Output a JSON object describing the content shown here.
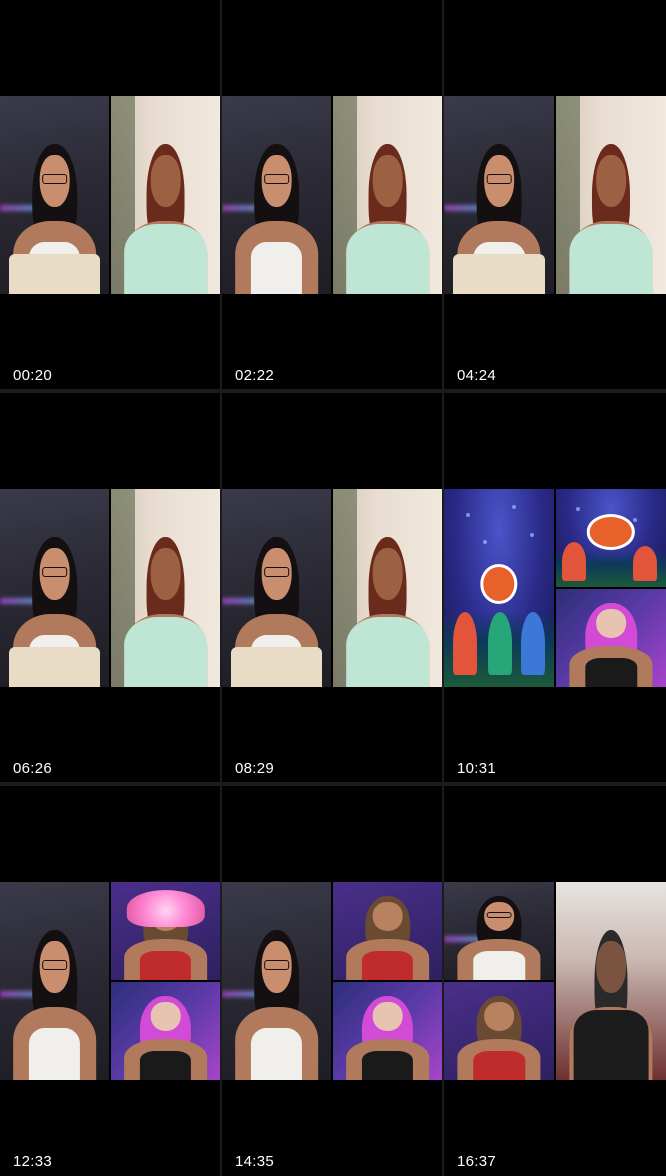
{
  "thumbnails": [
    {
      "timestamp": "00:20"
    },
    {
      "timestamp": "02:22"
    },
    {
      "timestamp": "04:24"
    },
    {
      "timestamp": "06:26"
    },
    {
      "timestamp": "08:29"
    },
    {
      "timestamp": "10:31"
    },
    {
      "timestamp": "12:33"
    },
    {
      "timestamp": "14:35"
    },
    {
      "timestamp": "16:37"
    }
  ]
}
